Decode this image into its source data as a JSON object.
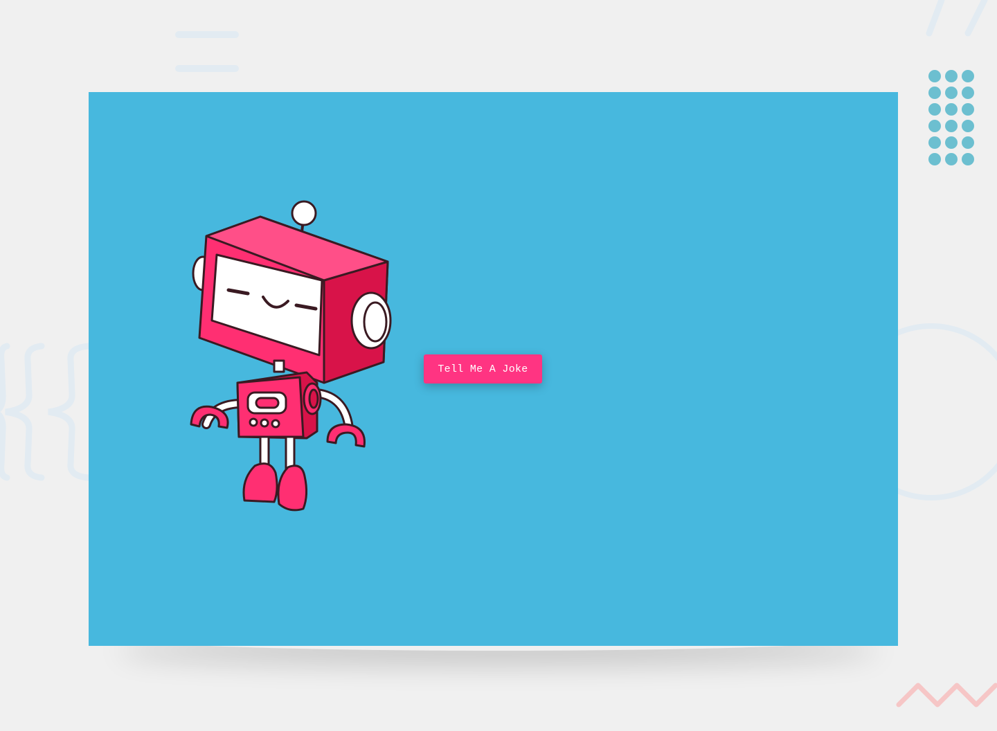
{
  "colors": {
    "background": "#f0f0f0",
    "card_background": "#47b8de",
    "button_background": "#ff3482",
    "button_text": "#ffffff",
    "robot_primary": "#ff2f72",
    "robot_dark": "#d81349",
    "deco_light": "#e2ebf2",
    "deco_dots": "#6cbfd0",
    "deco_zigzag": "#f6c6c6"
  },
  "robot": {
    "icon": "robot-illustration"
  },
  "joke_button": {
    "label": "Tell Me A Joke"
  }
}
